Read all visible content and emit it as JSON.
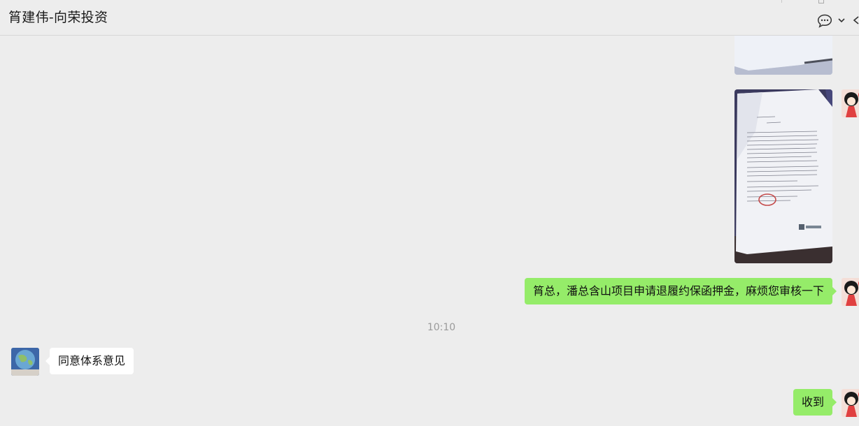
{
  "header": {
    "title": "筲建伟-向荣投资",
    "icons": [
      "chat-bubble-menu-icon",
      "chevron-down-icon",
      "back-edge-icon"
    ]
  },
  "messages": [
    {
      "type": "image",
      "sender": "self",
      "content": "document-photo-partial"
    },
    {
      "type": "image",
      "sender": "self",
      "content": "document-photo-with-red-stamp"
    },
    {
      "type": "text",
      "sender": "self",
      "text": "筲总，潘总含山项目申请退履约保函押金，麻烦您审核一下"
    },
    {
      "type": "time",
      "text": "10:10"
    },
    {
      "type": "text",
      "sender": "other",
      "text": "同意体系意见"
    },
    {
      "type": "text",
      "sender": "self",
      "text": "收到"
    }
  ],
  "colors": {
    "background": "#ededed",
    "self_bubble": "#95ec69",
    "other_bubble": "#ffffff",
    "timestamp": "#9a9a9a"
  }
}
